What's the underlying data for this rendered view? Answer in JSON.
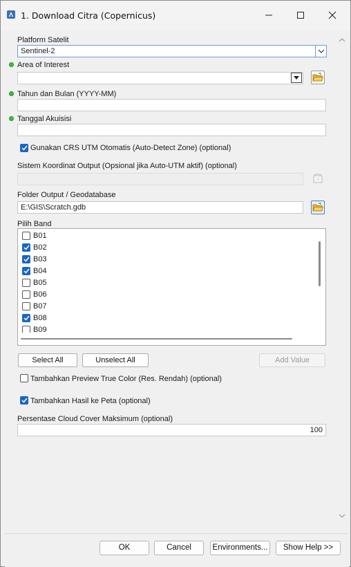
{
  "window": {
    "title": "1. Download Citra (Copernicus)"
  },
  "platform": {
    "label": "Platform Satelit",
    "value": "Sentinel-2"
  },
  "aoi": {
    "label": "Area of Interest",
    "value": ""
  },
  "year_month": {
    "label": "Tahun dan Bulan (YYYY-MM)",
    "value": ""
  },
  "acq_date": {
    "label": "Tanggal Akuisisi",
    "value": ""
  },
  "auto_utm": {
    "label": "Gunakan CRS UTM Otomatis (Auto-Detect Zone) (optional)",
    "checked": true
  },
  "output_crs": {
    "label": "Sistem Koordinat Output (Opsional jika Auto-UTM aktif) (optional)",
    "value": ""
  },
  "output_folder": {
    "label": "Folder Output / Geodatabase",
    "value": "E:\\GIS\\Scratch.gdb"
  },
  "bands": {
    "label": "Pilih Band",
    "items": [
      {
        "name": "B01",
        "checked": false
      },
      {
        "name": "B02",
        "checked": true
      },
      {
        "name": "B03",
        "checked": true
      },
      {
        "name": "B04",
        "checked": true
      },
      {
        "name": "B05",
        "checked": false
      },
      {
        "name": "B06",
        "checked": false
      },
      {
        "name": "B07",
        "checked": false
      },
      {
        "name": "B08",
        "checked": true
      },
      {
        "name": "B09",
        "checked": false
      }
    ],
    "select_all": "Select All",
    "unselect_all": "Unselect All",
    "add_value": "Add Value"
  },
  "preview": {
    "label": "Tambahkan Preview True Color (Res. Rendah) (optional)",
    "checked": false
  },
  "add_to_map": {
    "label": "Tambahkan Hasil ke Peta (optional)",
    "checked": true
  },
  "cloud_cover": {
    "label": "Persentase Cloud Cover Maksimum (optional)",
    "value": "100"
  },
  "footer": {
    "ok": "OK",
    "cancel": "Cancel",
    "environments": "Environments...",
    "show_help": "Show Help >>"
  },
  "colors": {
    "accent": "#1a66c2",
    "required_dot": "#3cc23c",
    "folder_icon": "#f0b429"
  },
  "icons": [
    "app-icon",
    "minimize-icon",
    "maximize-icon",
    "close-icon",
    "chevron-down-icon",
    "folder-open-icon",
    "crs-picker-icon",
    "scroll-up-icon",
    "scroll-down-icon"
  ]
}
